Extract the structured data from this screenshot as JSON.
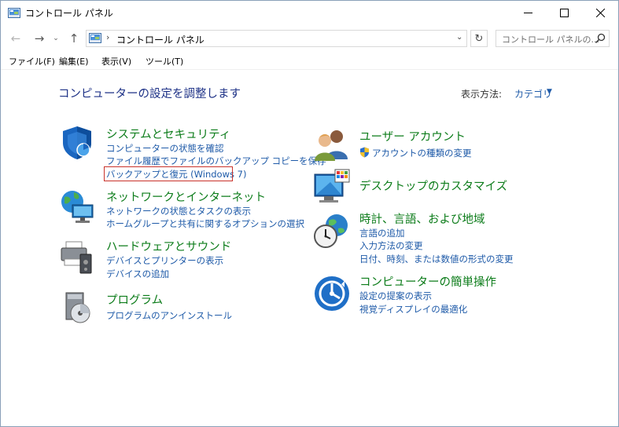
{
  "window": {
    "title": "コントロール パネル",
    "controls": {
      "minimize": "—",
      "maximize": "☐",
      "close": "✕"
    }
  },
  "navigation": {
    "address_separator": "›",
    "address_text": "コントロール パネル",
    "search_placeholder": "コントロール パネルの...",
    "back_glyph": "←",
    "forward_glyph": "→",
    "recent_glyph": "⌄",
    "up_glyph": "↑",
    "dropdown_glyph": "⌄",
    "refresh_glyph": "↻"
  },
  "menu": {
    "items": [
      "ファイル(F)",
      "編集(E)",
      "表示(V)",
      "ツール(T)"
    ]
  },
  "main": {
    "heading": "コンピューターの設定を調整します",
    "view_by_label": "表示方法:",
    "view_by_value": "カテゴリ",
    "view_by_caret": "▼"
  },
  "categories": {
    "system_security": {
      "title": "システムとセキュリティ",
      "links": [
        "コンピューターの状態を確認",
        "ファイル履歴でファイルのバックアップ コピーを保存",
        "バックアップと復元 (Windows 7)"
      ],
      "icon": "shield-icon"
    },
    "network": {
      "title": "ネットワークとインターネット",
      "links": [
        "ネットワークの状態とタスクの表示",
        "ホームグループと共有に関するオプションの選択"
      ],
      "icon": "network-globe-icon"
    },
    "hardware": {
      "title": "ハードウェアとサウンド",
      "links": [
        "デバイスとプリンターの表示",
        "デバイスの追加"
      ],
      "icon": "printer-speaker-icon"
    },
    "programs": {
      "title": "プログラム",
      "links": [
        "プログラムのアンインストール"
      ],
      "icon": "programs-disc-icon"
    },
    "user_accounts": {
      "title": "ユーザー アカウント",
      "links": [
        "アカウントの種類の変更"
      ],
      "icon": "users-icon"
    },
    "appearance": {
      "title": "デスクトップのカスタマイズ",
      "links": [],
      "icon": "monitor-palette-icon"
    },
    "clock_region": {
      "title": "時計、言語、および地域",
      "links": [
        "言語の追加",
        "入力方法の変更",
        "日付、時刻、または数値の形式の変更"
      ],
      "icon": "clock-globe-icon"
    },
    "ease_of_access": {
      "title": "コンピューターの簡単操作",
      "links": [
        "設定の提案の表示",
        "視覚ディスプレイの最適化"
      ],
      "icon": "ease-of-access-icon"
    }
  },
  "colors": {
    "category_title": "#0c7c1a",
    "link": "#1e5aa8",
    "heading": "#1e3287",
    "highlight_border": "#c9322b"
  }
}
